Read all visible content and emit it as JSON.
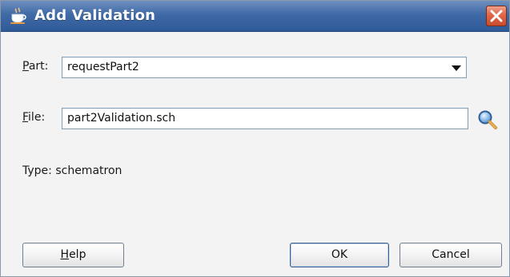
{
  "window": {
    "title": "Add Validation",
    "title_icon": "java-cup-icon",
    "close_icon": "close-icon"
  },
  "form": {
    "part": {
      "label_mnemonic": "P",
      "label_rest": "art:",
      "selected_value": "requestPart2"
    },
    "file": {
      "label_mnemonic": "F",
      "label_rest": "ile:",
      "value": "part2Validation.sch",
      "browse_icon": "magnifier-icon"
    },
    "type_text": "Type: schematron"
  },
  "buttons": {
    "help_mnemonic": "H",
    "help_rest": "elp",
    "ok": "OK",
    "cancel": "Cancel"
  },
  "colors": {
    "titlebar": "#3f6aa6",
    "close_button": "#e06a4b",
    "dialog_background": "#f3f3f3",
    "field_border": "#7f9db9"
  }
}
